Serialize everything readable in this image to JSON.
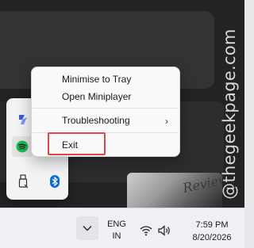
{
  "watermark": {
    "text": "@thegeekpage.com"
  },
  "background": {
    "thumbnail_text": "Review"
  },
  "context_menu": {
    "items": [
      {
        "label": "Minimise to Tray"
      },
      {
        "label": "Open Miniplayer"
      },
      {
        "label": "Troubleshooting",
        "has_submenu": true
      },
      {
        "label": "Exit",
        "highlighted": true
      }
    ],
    "highlight_color": "#e04848"
  },
  "tray_flyout": {
    "icons": [
      {
        "name": "power-automate-icon",
        "color": "#4a6cf7"
      },
      {
        "name": "spotify-icon",
        "color": "#1db954",
        "selected": true
      },
      {
        "name": "usb-drive-icon",
        "color": "#333333"
      },
      {
        "name": "bluetooth-icon",
        "color": "#0a6cd6"
      }
    ]
  },
  "taskbar": {
    "language": {
      "line1": "ENG",
      "line2": "IN"
    },
    "clock": {
      "time": "7:59 PM",
      "date": "8/20/2026"
    }
  }
}
